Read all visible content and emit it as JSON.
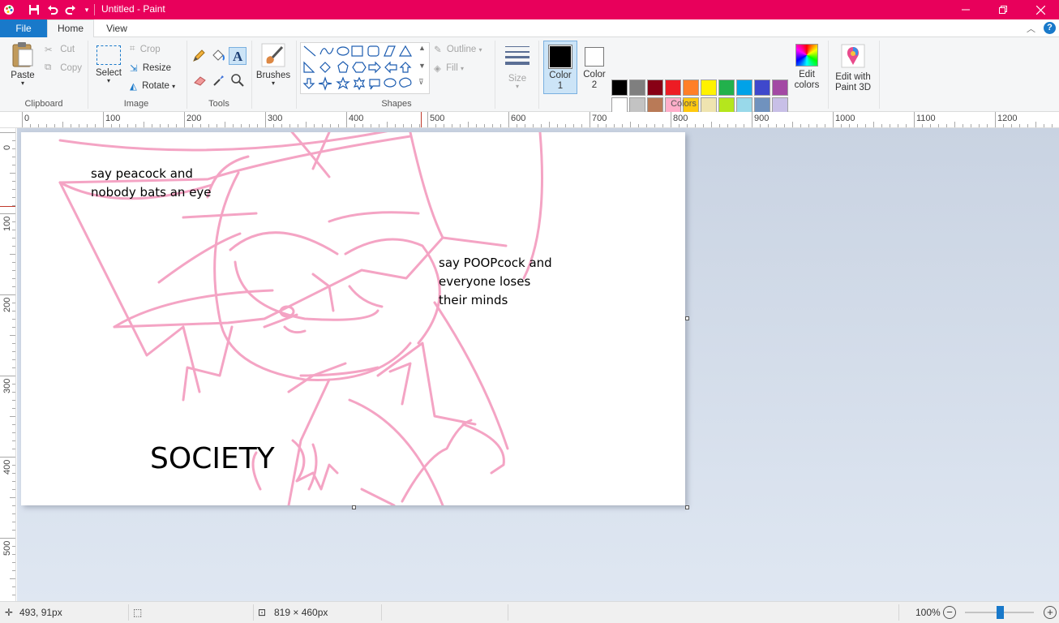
{
  "window": {
    "title": "Untitled - Paint",
    "accent": "#e8005b"
  },
  "tabs": {
    "file": "File",
    "home": "Home",
    "view": "View"
  },
  "ribbon": {
    "clipboard": {
      "paste": "Paste",
      "cut": "Cut",
      "copy": "Copy",
      "label": "Clipboard"
    },
    "image": {
      "select": "Select",
      "crop": "Crop",
      "resize": "Resize",
      "rotate": "Rotate",
      "label": "Image"
    },
    "tools": {
      "label": "Tools"
    },
    "brushes": "Brushes",
    "shapes": {
      "outline": "Outline",
      "fill": "Fill",
      "label": "Shapes"
    },
    "size": "Size",
    "color1": {
      "line1": "Color",
      "line2": "1",
      "value": "#000000"
    },
    "color2": {
      "line1": "Color",
      "line2": "2",
      "value": "#ffffff"
    },
    "colors_label": "Colors",
    "edit_colors": {
      "line1": "Edit",
      "line2": "colors"
    },
    "paint3d": {
      "line1": "Edit with",
      "line2": "Paint 3D"
    },
    "palette_row1": [
      "#000000",
      "#7f7f7f",
      "#880015",
      "#ed1c24",
      "#ff7f27",
      "#fff200",
      "#22b14c",
      "#00a2e8",
      "#3f48cc",
      "#a349a4"
    ],
    "palette_row2": [
      "#ffffff",
      "#c3c3c3",
      "#b97a57",
      "#ffaec9",
      "#ffc90e",
      "#efe4b0",
      "#b5e61d",
      "#99d9ea",
      "#7092be",
      "#c8bfe7"
    ]
  },
  "ruler": {
    "h_labels": [
      "0",
      "100",
      "200",
      "300",
      "400",
      "500",
      "600",
      "700",
      "800",
      "900",
      "1000",
      "1100",
      "1200"
    ],
    "v_labels": [
      "0",
      "100",
      "200",
      "300",
      "400",
      "500"
    ]
  },
  "canvas_text": {
    "top_left_1": "say peacock and",
    "top_left_2": "nobody bats an eye",
    "right_1": "say POOPcock and",
    "right_2": "everyone loses",
    "right_3": "their minds",
    "society": "SOCIETY",
    "sketch_color": "#f4a4c4"
  },
  "status": {
    "cursor_pos": "493, 91px",
    "image_size": "819 × 460px",
    "zoom": "100%"
  }
}
